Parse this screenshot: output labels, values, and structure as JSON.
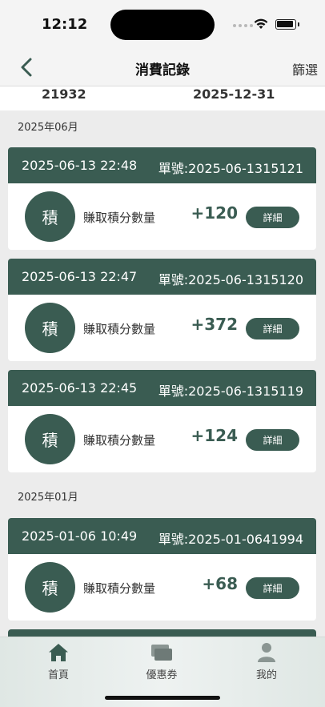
{
  "status": {
    "time": "12:12"
  },
  "nav": {
    "title": "消費記錄",
    "filter_label": "篩選"
  },
  "summary": {
    "left": "21932",
    "right": "2025-12-31"
  },
  "months": [
    {
      "label": "2025年06月"
    },
    {
      "label": "2025年01月"
    }
  ],
  "records": [
    {
      "date": "2025-06-13 22:48",
      "order": "單號:2025-06-1315121",
      "badge": "積",
      "desc": "賺取積分數量",
      "points": "+120",
      "detail": "詳細"
    },
    {
      "date": "2025-06-13 22:47",
      "order": "單號:2025-06-1315120",
      "badge": "積",
      "desc": "賺取積分數量",
      "points": "+372",
      "detail": "詳細"
    },
    {
      "date": "2025-06-13 22:45",
      "order": "單號:2025-06-1315119",
      "badge": "積",
      "desc": "賺取積分數量",
      "points": "+124",
      "detail": "詳細"
    },
    {
      "date": "2025-01-06 10:49",
      "order": "單號:2025-01-0641994",
      "badge": "積",
      "desc": "賺取積分數量",
      "points": "+68",
      "detail": "詳細"
    }
  ],
  "tabs": [
    {
      "label": "首頁",
      "icon": "home-icon"
    },
    {
      "label": "優惠券",
      "icon": "coupon-icon"
    },
    {
      "label": "我的",
      "icon": "profile-icon"
    }
  ],
  "colors": {
    "accent": "#3a5c52"
  }
}
